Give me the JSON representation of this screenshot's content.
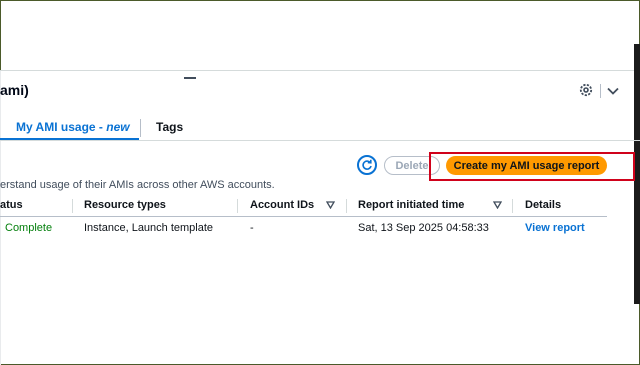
{
  "panel": {
    "title": "ami)"
  },
  "tabs": [
    {
      "label": "My AMI usage - ",
      "label_em": "new",
      "active": true
    },
    {
      "label": "Tags",
      "active": false
    }
  ],
  "toolbar": {
    "refresh_icon": "refresh-icon",
    "delete_label": "Delete",
    "create_label": "Create my AMI usage report"
  },
  "description": "erstand usage of their AMIs across other AWS accounts.",
  "table": {
    "columns": [
      {
        "label": "atus"
      },
      {
        "label": "Resource types"
      },
      {
        "label": "Account IDs",
        "sortable": true
      },
      {
        "label": "Report initiated time",
        "sortable": true
      },
      {
        "label": "Details"
      }
    ],
    "rows": [
      {
        "status": "Complete",
        "resource_types": "Instance, Launch template",
        "account_ids": "-",
        "initiated": "Sat, 13 Sep 2025 04:58:33",
        "details": "View report"
      }
    ]
  },
  "colors": {
    "accent": "#0972d3",
    "primary_button": "#ff9900",
    "success": "#037f0c",
    "highlight": "#d0021b"
  }
}
